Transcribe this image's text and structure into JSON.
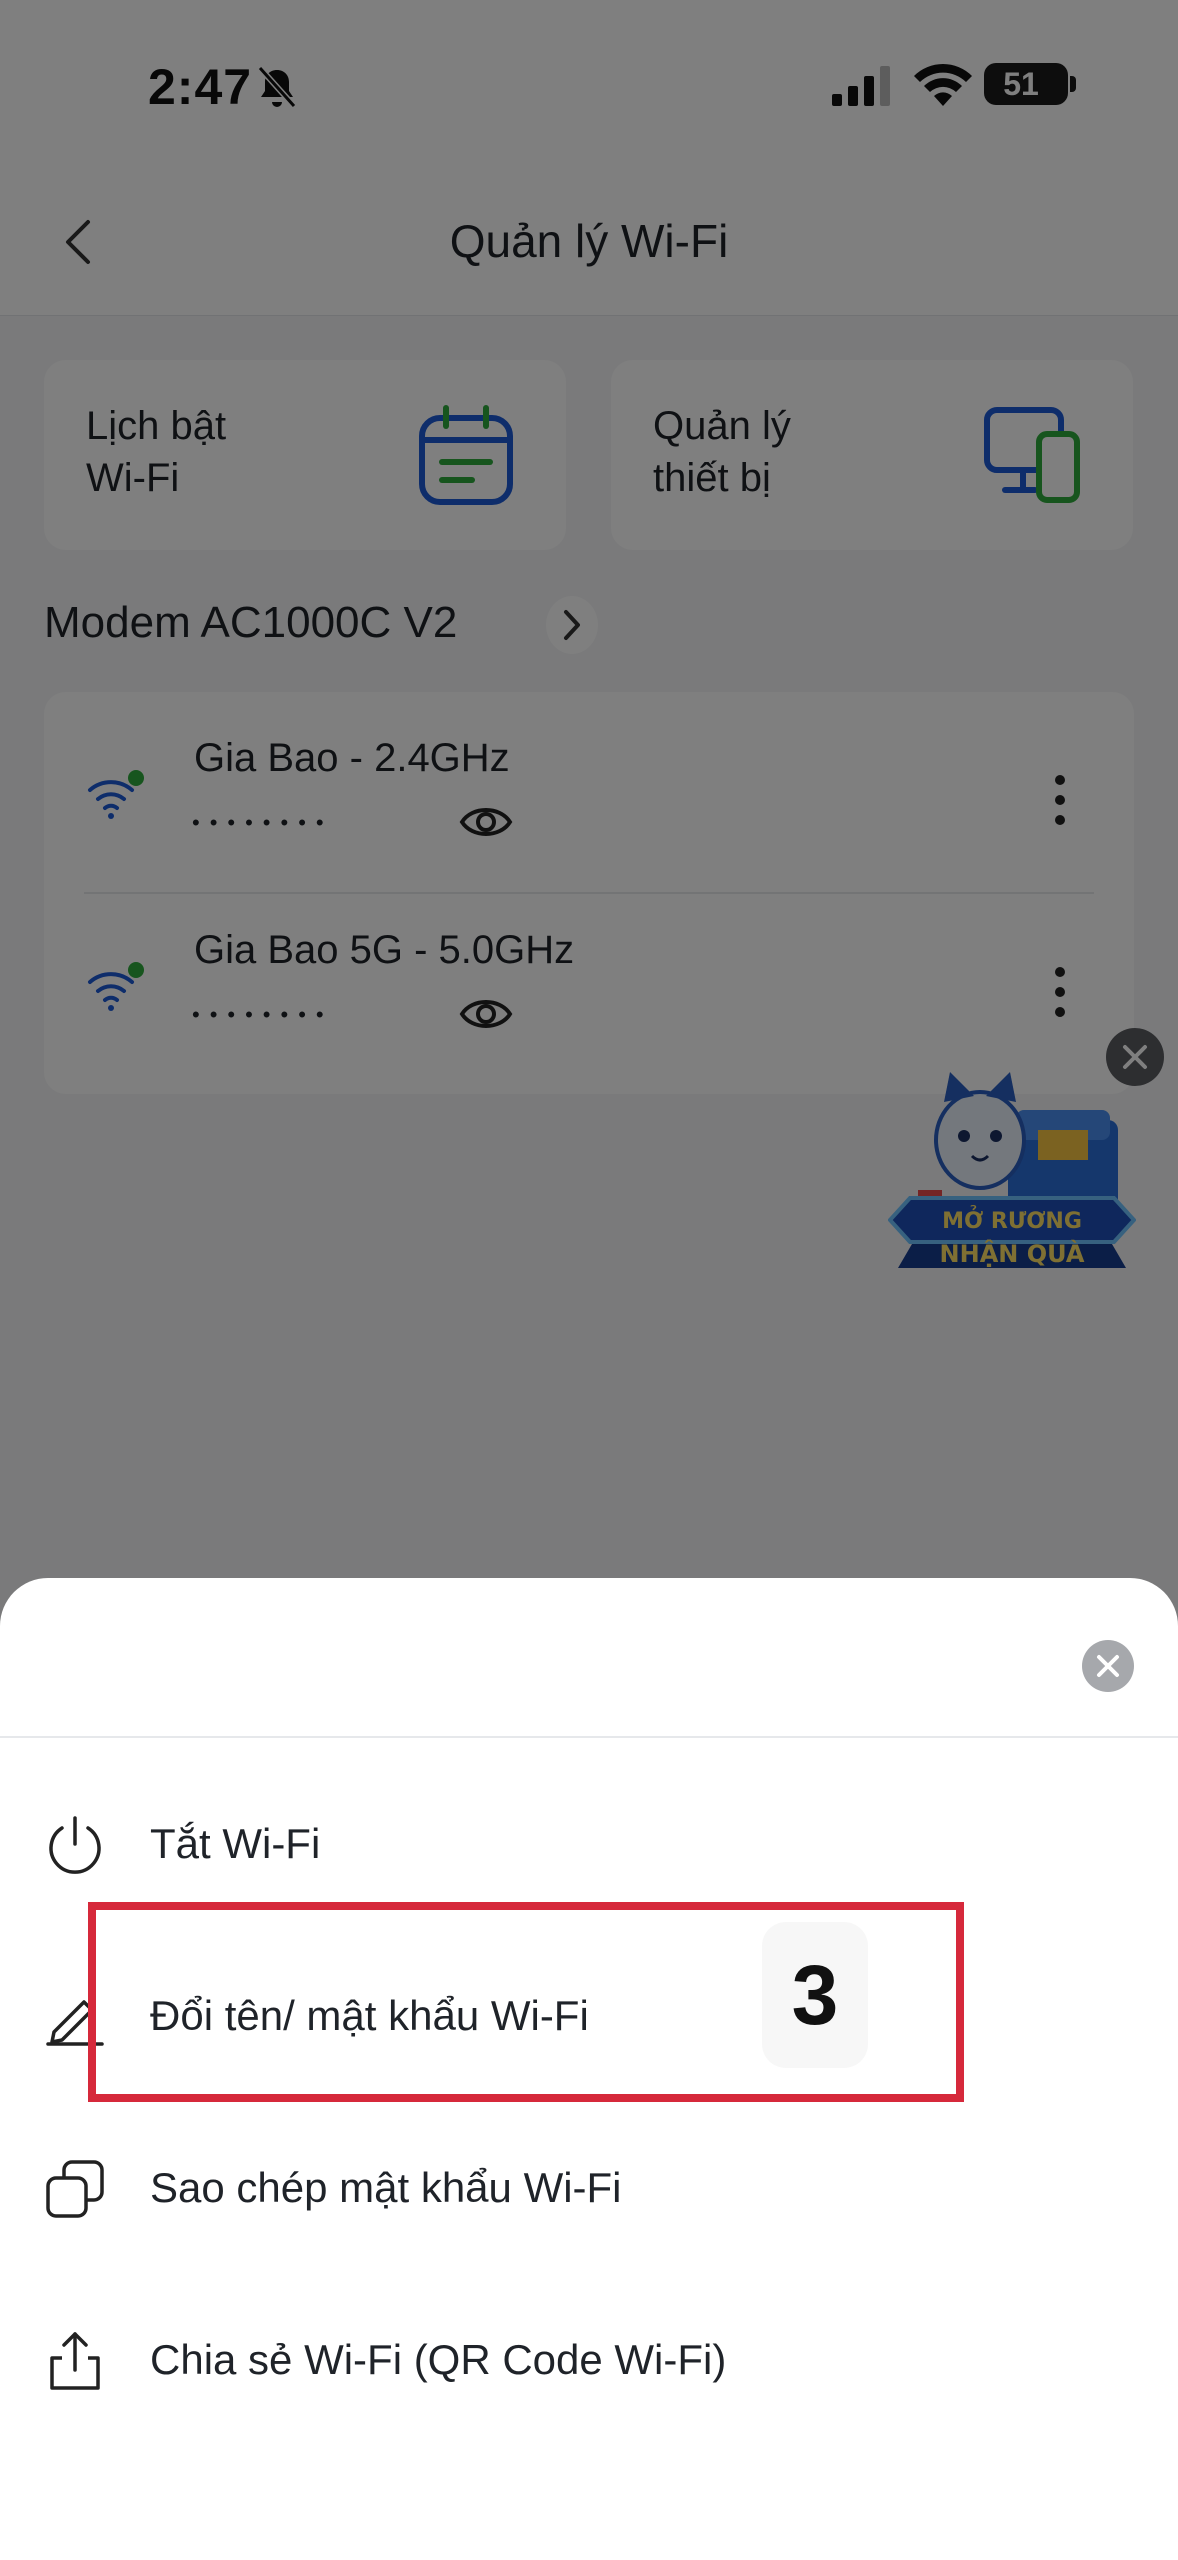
{
  "status_bar": {
    "time": "2:47",
    "battery": "51"
  },
  "header": {
    "title": "Quản lý Wi-Fi"
  },
  "tiles": [
    {
      "label": "Lịch bật\nWi-Fi",
      "icon": "calendar-icon",
      "color": "#1d5bd6"
    },
    {
      "label": "Quản lý\nthiết bị",
      "icon": "devices-icon",
      "color": "#1d5bd6"
    }
  ],
  "modem": {
    "name": "Modem AC1000C V2"
  },
  "networks": [
    {
      "name": "Gia Bao - 2.4GHz",
      "password_mask": "••••••••"
    },
    {
      "name": "Gia Bao 5G - 5.0GHz",
      "password_mask": "••••••••"
    }
  ],
  "promo": {
    "image": "promo-mascot-chest",
    "caption": "MỞ RƯƠNG NHẬN QUÀ"
  },
  "sheet": {
    "items": [
      {
        "label": "Tắt Wi-Fi",
        "icon": "power-icon"
      },
      {
        "label": "Đổi tên/ mật khẩu Wi-Fi",
        "icon": "edit-pencil-icon"
      },
      {
        "label": "Sao chép mật khẩu Wi-Fi",
        "icon": "copy-icon"
      },
      {
        "label": "Chia sẻ Wi-Fi (QR Code Wi-Fi)",
        "icon": "share-icon"
      }
    ]
  },
  "annotation": {
    "step": "3",
    "highlight_color": "#d6293b"
  },
  "colors": {
    "accent_blue": "#1d5bd6",
    "online_green": "#2eaa3c"
  }
}
